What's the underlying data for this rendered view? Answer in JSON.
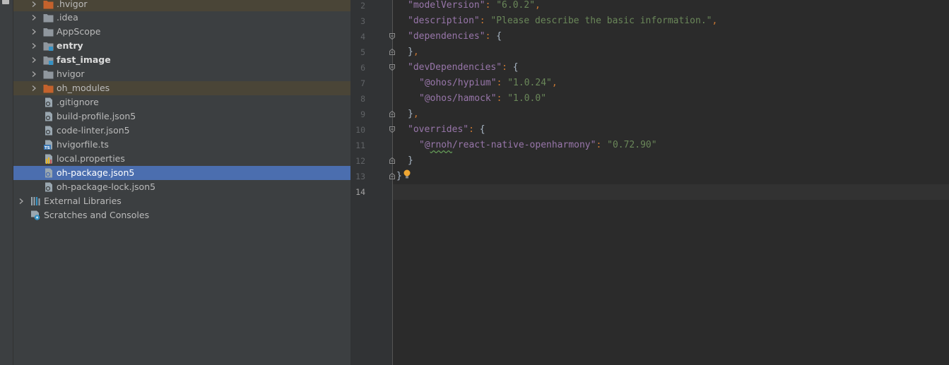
{
  "tree": {
    "items": [
      {
        "label": ".hvigor",
        "icon": "folder-orange-icon",
        "expandable": true
      },
      {
        "label": ".idea",
        "icon": "folder-icon",
        "expandable": true
      },
      {
        "label": "AppScope",
        "icon": "folder-icon",
        "expandable": true
      },
      {
        "label": "entry",
        "icon": "module-folder-icon",
        "expandable": true
      },
      {
        "label": "fast_image",
        "icon": "module-folder-icon",
        "expandable": true
      },
      {
        "label": "hvigor",
        "icon": "folder-icon",
        "expandable": true
      },
      {
        "label": "oh_modules",
        "icon": "folder-orange-icon",
        "expandable": true
      },
      {
        "label": ".gitignore",
        "icon": "file-icon",
        "expandable": false
      },
      {
        "label": "build-profile.json5",
        "icon": "json5-file-icon",
        "expandable": false
      },
      {
        "label": "code-linter.json5",
        "icon": "json5-file-icon",
        "expandable": false
      },
      {
        "label": "hvigorfile.ts",
        "icon": "typescript-file-icon",
        "expandable": false
      },
      {
        "label": "local.properties",
        "icon": "properties-file-icon",
        "expandable": false
      },
      {
        "label": "oh-package.json5",
        "icon": "json5-file-icon",
        "expandable": false
      },
      {
        "label": "oh-package-lock.json5",
        "icon": "json5-file-icon",
        "expandable": false
      },
      {
        "label": "External Libraries",
        "icon": "libraries-icon",
        "expandable": true
      },
      {
        "label": "Scratches and Consoles",
        "icon": "scratches-icon",
        "expandable": false
      }
    ]
  },
  "editor": {
    "line_numbers": [
      "2",
      "3",
      "4",
      "5",
      "6",
      "7",
      "8",
      "9",
      "10",
      "11",
      "12",
      "13",
      "14"
    ],
    "lines": [
      {
        "key": "\"modelVersion\"",
        "value": "\"6.0.2\""
      },
      {
        "key": "\"description\"",
        "value": "\"Please describe the basic information.\""
      },
      {
        "key": "\"dependencies\"",
        "open": "{"
      },
      {
        "close": "}"
      },
      {
        "key": "\"devDependencies\"",
        "open": "{"
      },
      {
        "key": "\"@ohos/hypium\"",
        "value": "\"1.0.24\""
      },
      {
        "key": "\"@ohos/hamock\"",
        "value": "\"1.0.0\""
      },
      {
        "close": "}"
      },
      {
        "key": "\"overrides\"",
        "open": "{"
      },
      {
        "key_prefix": "\"@",
        "key_squiggle": "rnoh",
        "key_suffix": "/react-native-openharmony\"",
        "value": "\"0.72.90\""
      },
      {
        "close": "}"
      },
      {
        "close": "}"
      }
    ],
    "punct": {
      "colon": ": ",
      "comma": ","
    }
  },
  "colors": {
    "key": "#9876aa",
    "string": "#6a8759",
    "punct": "#cc7832",
    "selection": "#4b6eaf",
    "excluded_row": "#4a4537"
  }
}
